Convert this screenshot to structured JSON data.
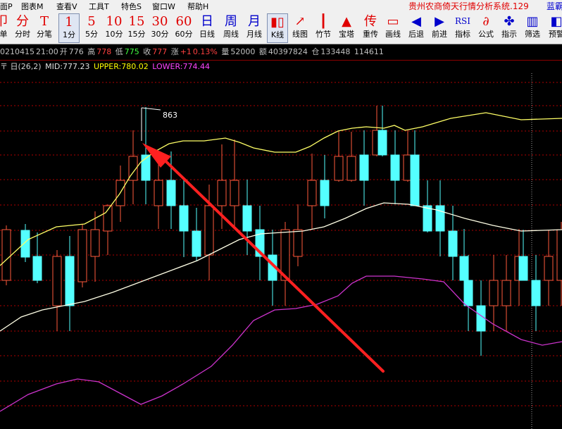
{
  "menu": {
    "items": [
      "面P",
      "图表M",
      "查看V",
      "工具T",
      "特色S",
      "窗口W",
      "帮助H"
    ],
    "title": "贵州农商倚天行情分析系统.129",
    "title_extra": "蓝霸"
  },
  "toolbar": {
    "buttons": [
      {
        "icon": "卩",
        "label": "单",
        "style": "red",
        "icon_name": "single-icon"
      },
      {
        "icon": "分",
        "label": "分时",
        "style": "red",
        "icon_name": "timeshare-icon"
      },
      {
        "icon": "T",
        "label": "分笔",
        "style": "red",
        "icon_name": "tick-icon"
      },
      {
        "icon": "1",
        "label": "1分",
        "style": "red",
        "active": true
      },
      {
        "icon": "5",
        "label": "5分",
        "style": "red"
      },
      {
        "icon": "10",
        "label": "10分",
        "style": "red"
      },
      {
        "icon": "15",
        "label": "15分",
        "style": "red"
      },
      {
        "icon": "30",
        "label": "30分",
        "style": "red"
      },
      {
        "icon": "60",
        "label": "60分",
        "style": "red"
      },
      {
        "icon": "日",
        "label": "日线",
        "style": "blue"
      },
      {
        "icon": "周",
        "label": "周线",
        "style": "blue"
      },
      {
        "icon": "月",
        "label": "月线",
        "style": "blue"
      },
      {
        "icon": "▮▯",
        "label": "K线",
        "style": "red",
        "active": true,
        "icon_name": "candlestick-icon"
      },
      {
        "icon": "↗",
        "label": "线图",
        "style": "red",
        "icon_name": "line-chart-icon"
      },
      {
        "icon": "┃",
        "label": "竹节",
        "style": "red",
        "icon_name": "bamboo-icon"
      },
      {
        "icon": "▲",
        "label": "宝塔",
        "style": "red",
        "icon_name": "tower-icon"
      },
      {
        "icon": "传",
        "label": "重传",
        "style": "red"
      },
      {
        "icon": "▭",
        "label": "画线",
        "style": "red",
        "icon_name": "draw-line-icon"
      },
      {
        "icon": "◀",
        "label": "后退",
        "style": "blue",
        "icon_name": "back-icon"
      },
      {
        "icon": "▶",
        "label": "前进",
        "style": "blue",
        "icon_name": "forward-icon"
      },
      {
        "icon": "RSI",
        "label": "指标",
        "style": "blue",
        "icon_name": "indicator-icon"
      },
      {
        "icon": "∂",
        "label": "公式",
        "style": "red",
        "icon_name": "formula-icon"
      },
      {
        "icon": "✤",
        "label": "指示",
        "style": "blue",
        "icon_name": "hint-icon"
      },
      {
        "icon": "▥",
        "label": "筛选",
        "style": "blue",
        "icon_name": "filter-icon"
      },
      {
        "icon": "◧",
        "label": "预警",
        "style": "blue",
        "icon_name": "alert-icon"
      }
    ]
  },
  "quote": {
    "date": "0210415",
    "time": "21:00",
    "open_label": "开",
    "open": "776",
    "high_label": "高",
    "high": "778",
    "low_label": "低",
    "low": "775",
    "close_label": "收",
    "close": "777",
    "change_label": "涨",
    "change": "+1",
    "change_pct": "0.13%",
    "volume_label": "量",
    "volume": "52000",
    "amount_label": "额",
    "amount": "40397824",
    "oi_label": "仓",
    "open_interest": "133448",
    "oi_extra": "114611"
  },
  "indicator": {
    "prefix": "〒 日(26,2)",
    "mid": "MID:777.23",
    "upper": "UPPER:780.02",
    "lower": "LOWER:774.44"
  },
  "chart": {
    "high_annotation": "863",
    "colors": {
      "up": "#ff5a3c",
      "down": "#54ffff",
      "upper": "#ffff66",
      "mid": "#ffffe6",
      "lower": "#cc33cc",
      "arrow": "#ff2020",
      "grid": "#b00000"
    }
  }
}
